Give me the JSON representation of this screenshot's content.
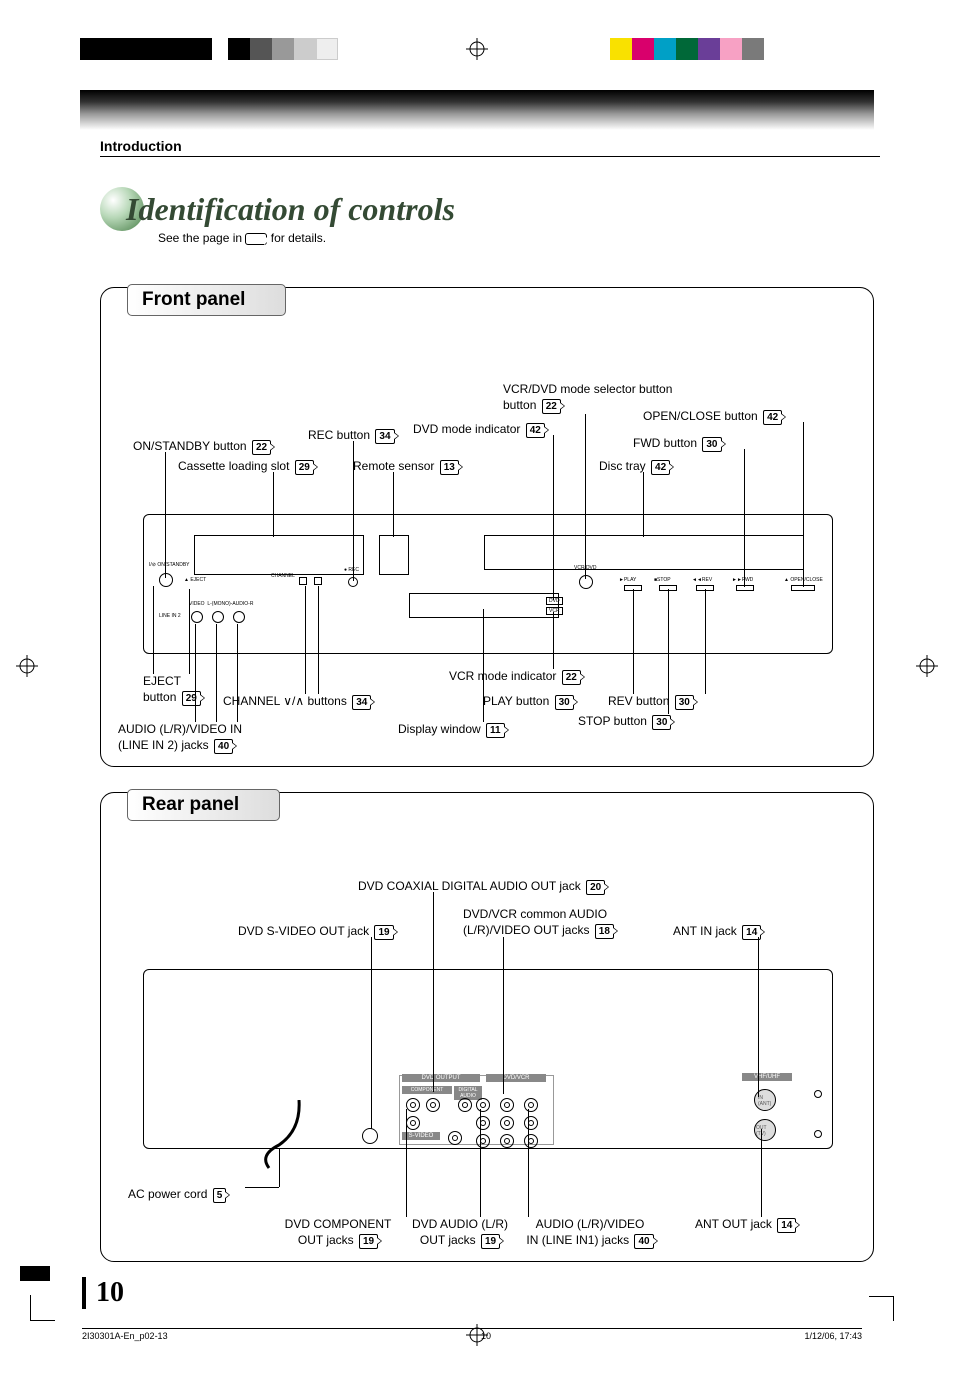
{
  "header": {
    "section": "Introduction"
  },
  "title": "Identification of controls",
  "subtitle_prefix": "See the page in ",
  "subtitle_suffix": " for details.",
  "front": {
    "panel_title": "Front panel",
    "callouts": [
      {
        "id": "vcrdvd-sel",
        "text": "VCR/DVD mode selector button",
        "page": "22"
      },
      {
        "id": "openclose",
        "text": "OPEN/CLOSE button",
        "page": "42"
      },
      {
        "id": "onstandby",
        "text": "ON/STANDBY button",
        "page": "22"
      },
      {
        "id": "rec",
        "text": "REC button",
        "page": "34"
      },
      {
        "id": "dvdmode",
        "text": "DVD mode indicator",
        "page": "42"
      },
      {
        "id": "fwd",
        "text": "FWD button",
        "page": "30"
      },
      {
        "id": "cassette",
        "text": "Cassette loading slot",
        "page": "29"
      },
      {
        "id": "remote",
        "text": "Remote sensor",
        "page": "13"
      },
      {
        "id": "disctray",
        "text": "Disc tray",
        "page": "42"
      },
      {
        "id": "vcrmode",
        "text": "VCR mode indicator",
        "page": "22"
      },
      {
        "id": "eject",
        "text": "EJECT button",
        "page": "29"
      },
      {
        "id": "channel",
        "text": "CHANNEL ∨/∧ buttons",
        "page": "34"
      },
      {
        "id": "play",
        "text": "PLAY button",
        "page": "30"
      },
      {
        "id": "rev",
        "text": "REV button",
        "page": "30"
      },
      {
        "id": "stop",
        "text": "STOP button",
        "page": "30"
      },
      {
        "id": "display",
        "text": "Display window",
        "page": "11"
      },
      {
        "id": "audioin",
        "text": "AUDIO (L/R)/VIDEO IN (LINE IN 2) jacks",
        "page": "40"
      }
    ]
  },
  "rear": {
    "panel_title": "Rear panel",
    "callouts": [
      {
        "id": "coax",
        "text": "DVD COAXIAL DIGITAL AUDIO OUT jack",
        "page": "20"
      },
      {
        "id": "svideo",
        "text": "DVD S-VIDEO OUT jack",
        "page": "19"
      },
      {
        "id": "common",
        "text": "DVD/VCR common AUDIO (L/R)/VIDEO OUT jacks",
        "page": "18"
      },
      {
        "id": "antin",
        "text": "ANT IN jack",
        "page": "14"
      },
      {
        "id": "accord",
        "text": "AC power cord",
        "page": "5"
      },
      {
        "id": "component",
        "text": "DVD COMPONENT OUT jacks",
        "page": "19"
      },
      {
        "id": "dvdaudio",
        "text": "DVD AUDIO (L/R) OUT jacks",
        "page": "19"
      },
      {
        "id": "linein1",
        "text": "AUDIO (L/R)/VIDEO IN (LINE IN1) jacks",
        "page": "40"
      },
      {
        "id": "antout",
        "text": "ANT OUT jack",
        "page": "14"
      }
    ]
  },
  "page_number": "10",
  "footer": {
    "file": "2I30301A-En_p02-13",
    "page": "10",
    "date": "1/12/06, 17:43"
  },
  "print_colors": [
    "#f9e100",
    "#d9006c",
    "#00a0c6",
    "#006838",
    "#6a3e98",
    "#f7a1c4",
    "#7a7a7a"
  ]
}
